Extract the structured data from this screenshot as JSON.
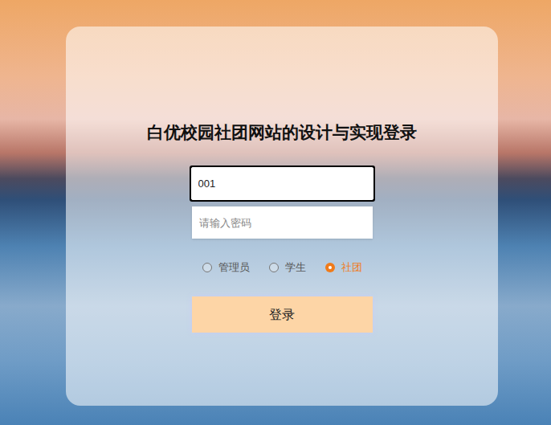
{
  "title": "白优校园社团网站的设计与实现登录",
  "username": {
    "value": "001",
    "focused": true
  },
  "password": {
    "placeholder": "请输入密码"
  },
  "roles": [
    {
      "label": "管理员",
      "selected": false
    },
    {
      "label": "学生",
      "selected": false
    },
    {
      "label": "社团",
      "selected": true
    }
  ],
  "login_button": "登录"
}
